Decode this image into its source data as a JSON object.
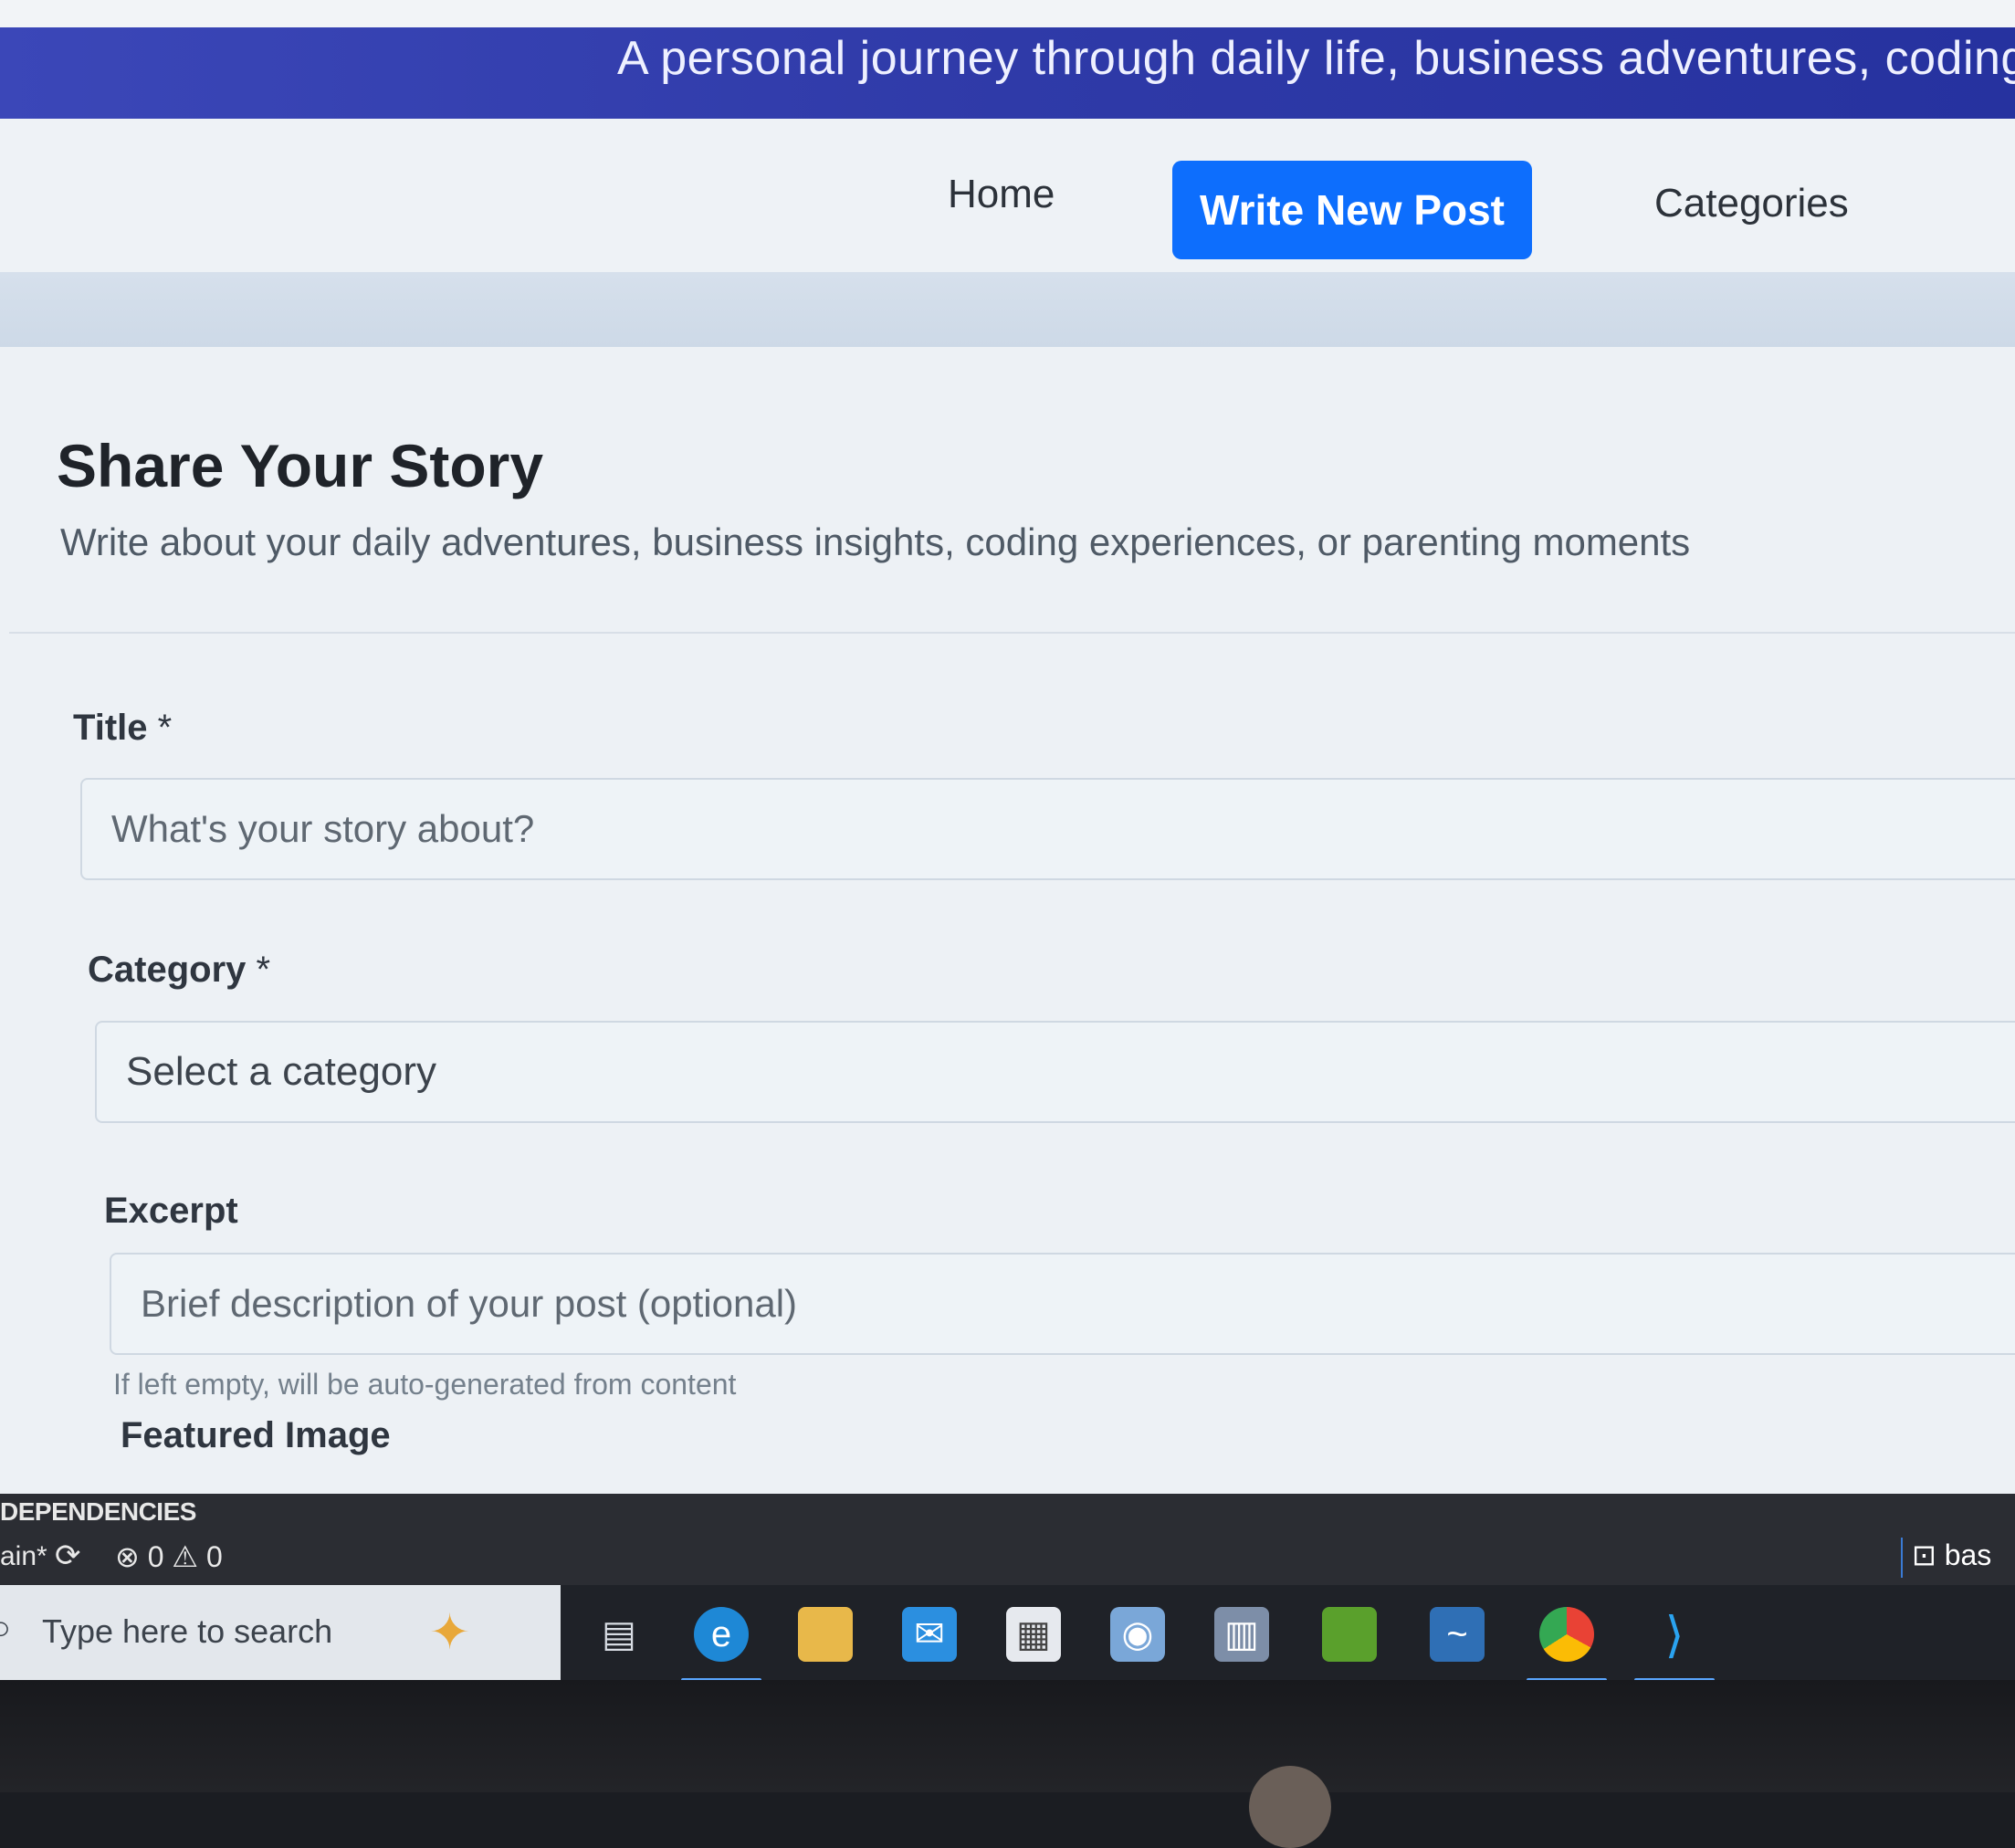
{
  "header": {
    "tagline": "A personal journey through daily life, business adventures, coding, and"
  },
  "nav": {
    "items": [
      "Home",
      "Write New Post",
      "Categories"
    ],
    "active": "Write New Post"
  },
  "form": {
    "title": "Share Your Story",
    "subtitle": "Write about your daily adventures, business insights, coding experiences, or parenting moments",
    "fields": {
      "title": {
        "label": "Title",
        "required_mark": "*",
        "placeholder": "What's your story about?"
      },
      "category": {
        "label": "Category",
        "required_mark": "*",
        "selected": "Select a category"
      },
      "excerpt": {
        "label": "Excerpt",
        "placeholder": "Brief description of your post (optional)",
        "help": "If left empty, will be auto-generated from content"
      },
      "featured_image": {
        "label": "Featured Image"
      }
    }
  },
  "statusbar": {
    "section": "DEPENDENCIES",
    "branch": "ain*",
    "problems": "⊗ 0 ⚠ 0",
    "terminal": "bas"
  },
  "taskbar": {
    "search_placeholder": "Type here to search",
    "apps": [
      "task-view",
      "edge",
      "file-explorer",
      "mail",
      "store",
      "camera",
      "calculator",
      "minecraft",
      "mysql-workbench",
      "chrome",
      "vscode"
    ]
  },
  "colors": {
    "banner": "#2f3aa8",
    "accent": "#0d6efd",
    "page_bg": "#e6ecf2"
  }
}
